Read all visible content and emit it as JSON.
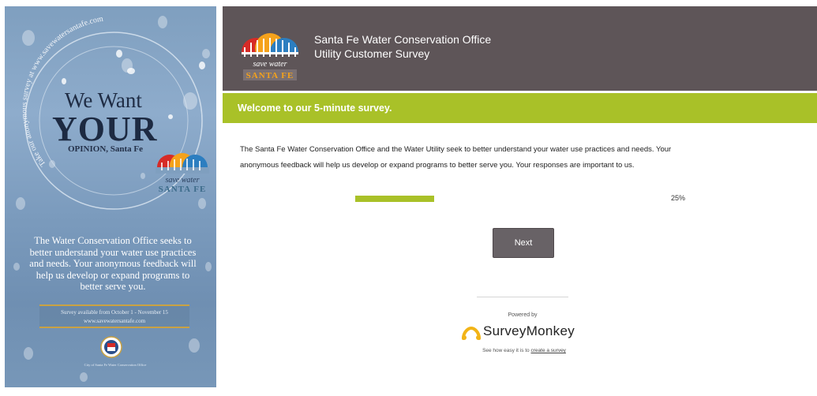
{
  "poster": {
    "arc_text": "Take our anonymous survey at www.savewatersantafe.com",
    "we_want": "We Want",
    "your": "YOUR",
    "opinion": "OPINION, Santa Fe",
    "logo_line1": "save water",
    "logo_line2": "SANTA FE",
    "body": "The Water Conservation Office seeks to better understand your water use practices and needs. Your anonymous feedback will help us develop or expand programs to better serve you.",
    "availability_line1": "Survey available from October 1 - November 15",
    "availability_line2": "www.savewatersantafe.com",
    "seal_caption": "City of Santa Fe Water Conservation Office"
  },
  "survey": {
    "logo_line1": "save water",
    "logo_line2": "SANTA FE",
    "org_line1": "Santa Fe Water Conservation Office",
    "org_line2": "Utility Customer Survey",
    "welcome": "Welcome to our 5-minute survey.",
    "intro_line1": "The Santa Fe Water Conservation Office and the Water Utility seek to better understand your water use practices and needs. Your",
    "intro_line2": "anonymous feedback will help us develop or expand programs to better serve you. Your responses are important to us.",
    "progress_value": 0.25,
    "progress_label": "25%",
    "next_label": "Next",
    "powered_by": "Powered by",
    "brand": "SurveyMonkey",
    "see_how_prefix": "See how easy it is to",
    "see_how_link": "create a survey"
  },
  "colors": {
    "banner": "#5e5558",
    "accent_green": "#a9c128",
    "button": "#686266",
    "brand_yellow": "#f2b417",
    "logo_red": "#d62b27",
    "logo_orange": "#f5a21b",
    "logo_blue": "#2c7ec0"
  },
  "icons": [
    "save-water-logo-icon",
    "city-seal-icon",
    "surveymonkey-logo-icon"
  ]
}
